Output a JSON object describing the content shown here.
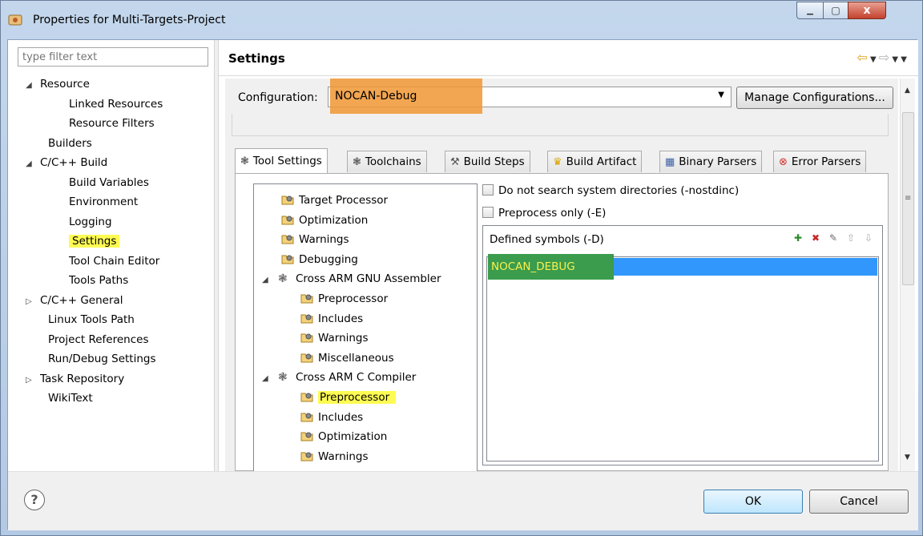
{
  "window": {
    "title": "Properties for Multi-Targets-Project",
    "close_glyph": "x",
    "min_glyph": "▁",
    "max_glyph": "▢"
  },
  "left_panel": {
    "filter_placeholder": "type filter text",
    "items": [
      {
        "label": "Resource",
        "expander": "◢",
        "level": 0
      },
      {
        "label": "Linked Resources",
        "expander": "",
        "level": 1
      },
      {
        "label": "Resource Filters",
        "expander": "",
        "level": 1
      },
      {
        "label": "Builders",
        "expander": "",
        "level": 0
      },
      {
        "label": "C/C++ Build",
        "expander": "◢",
        "level": 0
      },
      {
        "label": "Build Variables",
        "expander": "",
        "level": 1
      },
      {
        "label": "Environment",
        "expander": "",
        "level": 1
      },
      {
        "label": "Logging",
        "expander": "",
        "level": 1
      },
      {
        "label": "Settings",
        "expander": "",
        "level": 1,
        "highlighted": true
      },
      {
        "label": "Tool Chain Editor",
        "expander": "",
        "level": 1
      },
      {
        "label": "Tools Paths",
        "expander": "",
        "level": 1
      },
      {
        "label": "C/C++ General",
        "expander": "▷",
        "level": 0
      },
      {
        "label": "Linux Tools Path",
        "expander": "",
        "level": 0
      },
      {
        "label": "Project References",
        "expander": "",
        "level": 0
      },
      {
        "label": "Run/Debug Settings",
        "expander": "",
        "level": 0
      },
      {
        "label": "Task Repository",
        "expander": "▷",
        "level": 0
      },
      {
        "label": "WikiText",
        "expander": "",
        "level": 0
      }
    ]
  },
  "right_panel": {
    "title": "Settings",
    "configuration_label": "Configuration:",
    "configuration_value": "NOCAN-Debug",
    "manage_button": "Manage Configurations...",
    "tabs": [
      {
        "label": "Tool Settings",
        "icon": "gear-icon",
        "active": true
      },
      {
        "label": "Toolchains",
        "icon": "gear-icon"
      },
      {
        "label": "Build Steps",
        "icon": "hammer-icon"
      },
      {
        "label": "Build Artifact",
        "icon": "trophy-icon"
      },
      {
        "label": "Binary Parsers",
        "icon": "binary-icon"
      },
      {
        "label": "Error Parsers",
        "icon": "error-icon"
      }
    ],
    "tool_tree": [
      {
        "label": "Target Processor",
        "type": "option",
        "level": 0
      },
      {
        "label": "Optimization",
        "type": "option",
        "level": 0
      },
      {
        "label": "Warnings",
        "type": "option",
        "level": 0
      },
      {
        "label": "Debugging",
        "type": "option",
        "level": 0
      },
      {
        "label": "Cross ARM GNU Assembler",
        "type": "tool",
        "level": 0
      },
      {
        "label": "Preprocessor",
        "type": "option",
        "level": 1
      },
      {
        "label": "Includes",
        "type": "option",
        "level": 1
      },
      {
        "label": "Warnings",
        "type": "option",
        "level": 1
      },
      {
        "label": "Miscellaneous",
        "type": "option",
        "level": 1
      },
      {
        "label": "Cross ARM C Compiler",
        "type": "tool",
        "level": 0
      },
      {
        "label": "Preprocessor",
        "type": "option",
        "level": 1,
        "highlighted": true
      },
      {
        "label": "Includes",
        "type": "option",
        "level": 1
      },
      {
        "label": "Optimization",
        "type": "option",
        "level": 1
      },
      {
        "label": "Warnings",
        "type": "option",
        "level": 1
      }
    ],
    "options": {
      "nostdinc_label": "Do not search system directories (-nostdinc)",
      "preprocess_only_label": "Preprocess only (-E)",
      "defined_symbols_label": "Defined symbols (-D)",
      "symbols": [
        "NOCAN_DEBUG"
      ]
    }
  },
  "bottom": {
    "help_glyph": "?",
    "ok_label": "OK",
    "cancel_label": "Cancel"
  }
}
